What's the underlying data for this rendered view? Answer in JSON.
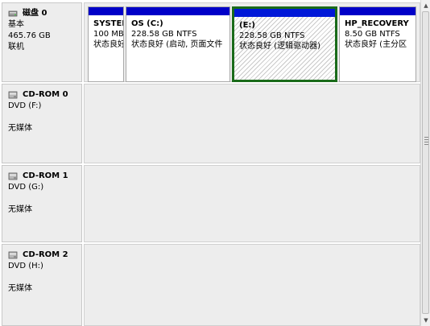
{
  "disks": [
    {
      "title": "磁盘 0",
      "lines": [
        "基本",
        "465.76 GB",
        "联机"
      ],
      "icon": "hard-disk-icon",
      "partitions": [
        {
          "name": "SYSTEM",
          "size": "100 MB",
          "status": "状态良好"
        },
        {
          "name": "OS (C:)",
          "size": "228.58 GB NTFS",
          "status": "状态良好 (启动, 页面文件"
        },
        {
          "name": "(E:)",
          "size": "228.58 GB NTFS",
          "status": "状态良好 (逻辑驱动器)",
          "selected": true
        },
        {
          "name": "HP_RECOVERY",
          "size": "8.50 GB NTFS",
          "status": "状态良好 (主分区"
        }
      ]
    },
    {
      "title": "CD-ROM 0",
      "lines": [
        "DVD (F:)",
        "",
        "无媒体"
      ],
      "icon": "cdrom-icon"
    },
    {
      "title": "CD-ROM 1",
      "lines": [
        "DVD (G:)",
        "",
        "无媒体"
      ],
      "icon": "cdrom-icon"
    },
    {
      "title": "CD-ROM 2",
      "lines": [
        "DVD (H:)",
        "",
        "无媒体"
      ],
      "icon": "cdrom-icon"
    }
  ],
  "colors": {
    "partition_bar": "#0000c8",
    "selected_border": "#1a6b1a",
    "row_background": "#ededed"
  }
}
